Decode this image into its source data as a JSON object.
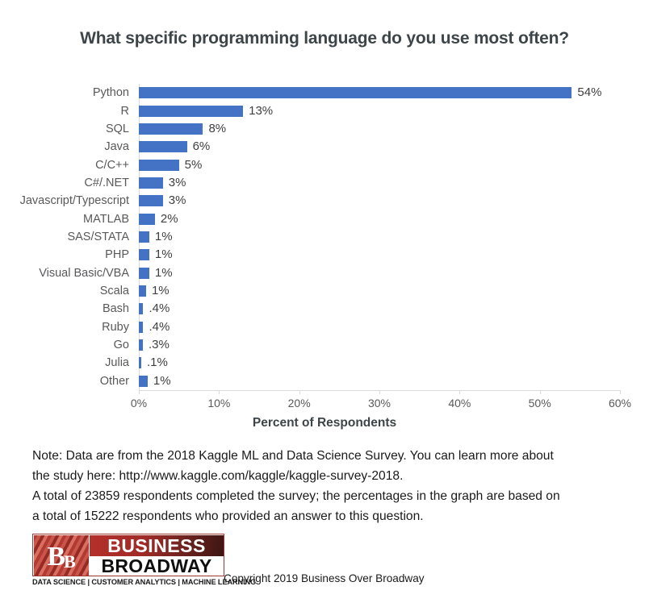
{
  "chart_data": {
    "type": "bar",
    "orientation": "horizontal",
    "title": "What specific programming language do you use most often?",
    "xlabel": "Percent of Respondents",
    "ylabel": "",
    "xlim": [
      0,
      60
    ],
    "xticks": [
      "0%",
      "10%",
      "20%",
      "30%",
      "40%",
      "50%",
      "60%"
    ],
    "xtick_values": [
      0,
      10,
      20,
      30,
      40,
      50,
      60
    ],
    "grid": false,
    "legend": null,
    "series_color": "#4472C4",
    "categories": [
      "Python",
      "R",
      "SQL",
      "Java",
      "C/C++",
      "C#/.NET",
      "Javascript/Typescript",
      "MATLAB",
      "SAS/STATA",
      "PHP",
      "Visual Basic/VBA",
      "Scala",
      "Bash",
      "Ruby",
      "Go",
      "Julia",
      "Other"
    ],
    "values": [
      54,
      13,
      8,
      6,
      5,
      3,
      3,
      2,
      1,
      1,
      1,
      1,
      0.4,
      0.4,
      0.3,
      0.1,
      1
    ],
    "data_labels": [
      "54%",
      "13%",
      "8%",
      "6%",
      "5%",
      "3%",
      "3%",
      "2%",
      "1%",
      "1%",
      "1%",
      "1%",
      ".4%",
      ".4%",
      ".3%",
      ".1%",
      "1%"
    ],
    "bar_draw_percent": [
      54,
      13,
      8,
      6,
      5,
      3,
      3,
      2,
      1.3,
      1.3,
      1.3,
      0.9,
      0.55,
      0.55,
      0.5,
      0.2,
      1.1
    ]
  },
  "note": {
    "line1": "Note: Data are from the 2018 Kaggle ML and Data Science Survey. You can learn more about",
    "line2": "the study here: http://www.kaggle.com/kaggle/kaggle-survey-2018.",
    "line3": "A total of 23859 respondents completed the survey; the percentages in the graph are based on",
    "line4": "a total of 15222 respondents who provided an answer to this question."
  },
  "footer": {
    "logo": {
      "monogram": "B",
      "monogram_sub": "B",
      "word_top": "BUSINESS",
      "word_bottom": "BROADWAY",
      "tagline": "DATA SCIENCE  |  CUSTOMER ANALYTICS  |  MACHINE LEARNING"
    },
    "copyright": "Copyright 2019  Business Over Broadway"
  }
}
